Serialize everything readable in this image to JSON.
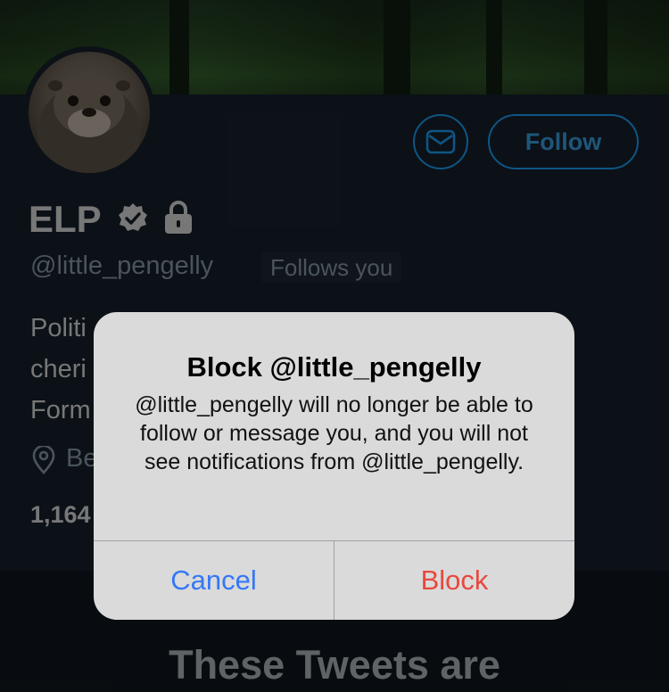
{
  "profile": {
    "name": "ELP",
    "handle": "@little_pengelly",
    "follows_you": "Follows you",
    "follow_label": "Follow",
    "bio_lines": [
      "Politi",
      "cheri",
      "Form"
    ],
    "location": "Be",
    "following_count": "1,164"
  },
  "tweets_heading": "These Tweets are",
  "dialog": {
    "title": "Block @little_pengelly",
    "message": "@little_pengelly will no longer be able to follow or message you, and you will not see notifications from @little_pengelly.",
    "cancel_label": "Cancel",
    "block_label": "Block"
  },
  "colors": {
    "accent": "#1d9bf0",
    "cancel": "#3478f6",
    "block": "#e9473d",
    "background": "#15202b"
  },
  "icons": [
    "mail-icon",
    "verified-badge-icon",
    "lock-icon",
    "location-pin-icon"
  ]
}
